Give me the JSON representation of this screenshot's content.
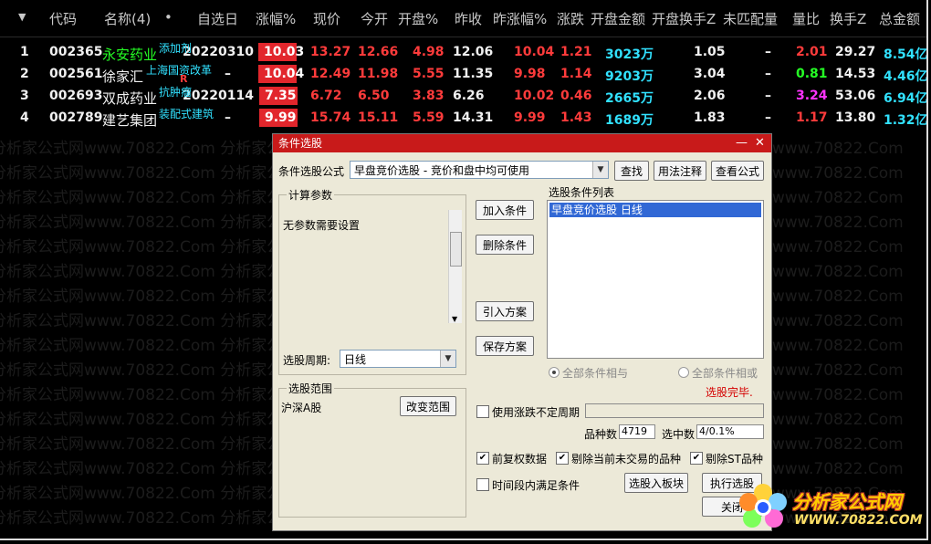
{
  "header": {
    "dropdown_glyph": "▼",
    "columns": [
      "代码",
      "名称(4)",
      "•",
      "自选日",
      "涨幅%",
      "现价",
      "今开",
      "开盘%",
      "昨收",
      "昨涨幅%",
      "涨跌",
      "开盘金额",
      "开盘换手Z",
      "未匹配量",
      "量比",
      "换手Z",
      "总金额"
    ]
  },
  "rows": [
    {
      "no": "1",
      "code": "002365",
      "name": "永安药业",
      "tag": "添加剂",
      "tag2": "",
      "date": "20220310",
      "pct": "10.03",
      "price": "13.27",
      "open": "12.66",
      "open_pct": "4.98",
      "prev": "12.06",
      "prev_pct": "10.04",
      "chg": "1.21",
      "open_amt": "3023万",
      "open_turn": "1.05",
      "unmatched": "–",
      "vol_ratio": "2.01",
      "turn": "29.27",
      "total": "8.54亿"
    },
    {
      "no": "2",
      "code": "002561",
      "name": "徐家汇",
      "tag": "上海国资改革",
      "tag2": "R",
      "date": "–",
      "pct": "10.04",
      "price": "12.49",
      "open": "11.98",
      "open_pct": "5.55",
      "prev": "11.35",
      "prev_pct": "9.98",
      "chg": "1.14",
      "open_amt": "9203万",
      "open_turn": "3.04",
      "unmatched": "–",
      "vol_ratio": "0.81",
      "turn": "14.53",
      "total": "4.46亿"
    },
    {
      "no": "3",
      "code": "002693",
      "name": "双成药业",
      "tag": "抗肿瘤",
      "tag2": "",
      "date": "20220114",
      "pct": "7.35",
      "price": "6.72",
      "open": "6.50",
      "open_pct": "3.83",
      "prev": "6.26",
      "prev_pct": "10.02",
      "chg": "0.46",
      "open_amt": "2665万",
      "open_turn": "2.06",
      "unmatched": "–",
      "vol_ratio": "3.24",
      "turn": "53.06",
      "total": "6.94亿"
    },
    {
      "no": "4",
      "code": "002789",
      "name": "建艺集团",
      "tag": "装配式建筑",
      "tag2": "",
      "date": "–",
      "pct": "9.99",
      "price": "15.74",
      "open": "15.11",
      "open_pct": "5.59",
      "prev": "14.31",
      "prev_pct": "9.99",
      "chg": "1.43",
      "open_amt": "1689万",
      "open_turn": "1.83",
      "unmatched": "–",
      "vol_ratio": "1.17",
      "turn": "13.80",
      "total": "1.32亿"
    }
  ],
  "watermark": "分析家公式网www.70822.Com",
  "dialog": {
    "title": "条件选股",
    "min_glyph": "—",
    "close_glyph": "✕",
    "formula_label": "条件选股公式",
    "formula_value": "早盘竞价选股 - 竞价和盘中均可使用",
    "find": "查找",
    "usage": "用法注释",
    "view_formula": "查看公式",
    "calc_params": "计算参数",
    "no_params": "无参数需要设置",
    "add_cond": "加入条件",
    "del_cond": "删除条件",
    "import_plan": "引入方案",
    "save_plan": "保存方案",
    "cond_list_label": "选股条件列表",
    "cond_item": "早盘竞价选股  日线",
    "period_label": "选股周期:",
    "period_value": "日线",
    "all_and": "全部条件相与",
    "all_or": "全部条件相或",
    "range_label": "选股范围",
    "range_value": "沪深A股",
    "change_range": "改变范围",
    "status": "选股完毕.",
    "use_uncertain": "使用涨跌不定周期",
    "count_label": "品种数",
    "count_value": "4719",
    "selected_label": "选中数",
    "selected_value": "4/0.1%",
    "pre_adjust": "前复权数据",
    "exclude_untraded": "剔除当前未交易的品种",
    "exclude_st": "剔除ST品种",
    "time_range": "时间段内满足条件",
    "to_block": "选股入板块",
    "execute": "执行选股",
    "close": "关闭"
  },
  "logo": {
    "text": "分析家公式网",
    "url": "WWW.70822.COM"
  }
}
